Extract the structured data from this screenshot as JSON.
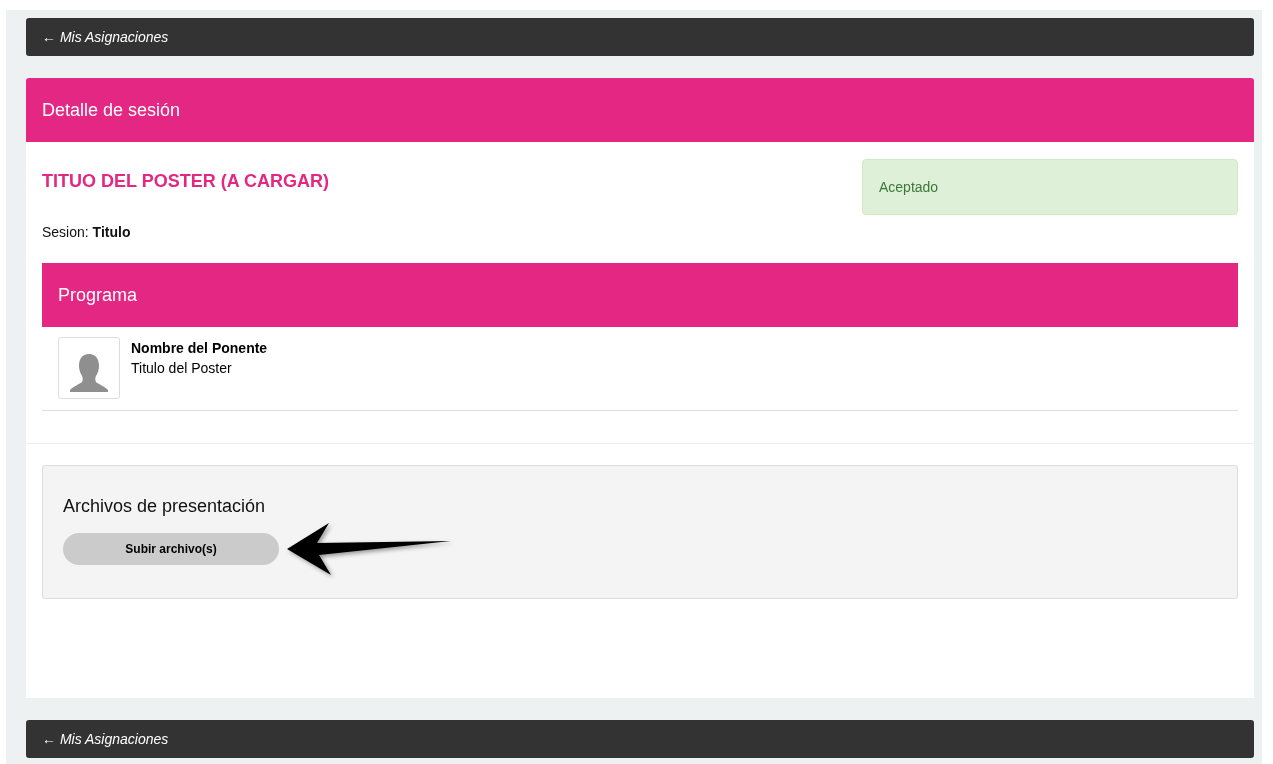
{
  "back_link_top": {
    "arrow": "←",
    "label": "Mis Asignaciones"
  },
  "session_panel": {
    "title": "Detalle de sesión",
    "poster_title": "TITUO DEL POSTER (A CARGAR)",
    "status": {
      "text": "Aceptado",
      "kind": "success"
    },
    "session_label": "Sesion:",
    "session_value": "Titulo",
    "program": {
      "title": "Programa",
      "speakers": [
        {
          "name": "Nombre del Ponente",
          "poster": "Titulo del Poster"
        }
      ]
    }
  },
  "files_panel": {
    "title": "Archivos de presentación",
    "button": "Subir archivo(s)"
  },
  "back_link_bottom": {
    "arrow": "←",
    "label": "Mis Asignaciones"
  }
}
